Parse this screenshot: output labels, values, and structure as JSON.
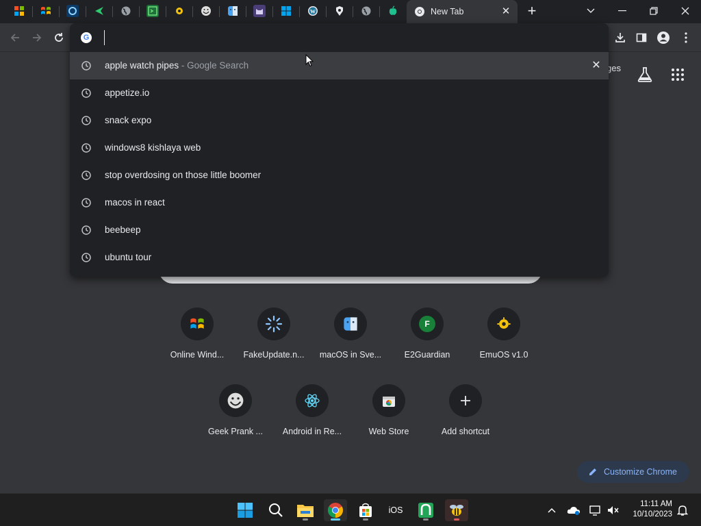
{
  "colors": {
    "accent": "#8ab4f8",
    "tab_bg": "#202124",
    "surface": "#35363a",
    "taskbar": "#1f1f1f"
  },
  "tabs": {
    "pinned_icons": [
      "windows-logo-icon",
      "windows-xp-logo-icon",
      "circle-logo-icon",
      "arrow-logo-icon",
      "globe-icon",
      "green-terminal-icon",
      "yellow-bug-icon",
      "troll-face-icon",
      "finder-icon",
      "cat-icon",
      "windows-icon",
      "wordpress-icon",
      "gear-logo-icon",
      "globe-icon",
      "green-apple-icon"
    ],
    "active_title": "New Tab"
  },
  "omnibox": {
    "value": "",
    "suggestions": [
      {
        "text": "apple watch pipes",
        "sub": " - Google Search"
      },
      {
        "text": "appetize.io",
        "sub": ""
      },
      {
        "text": "snack expo",
        "sub": ""
      },
      {
        "text": "windows8 kishlaya web",
        "sub": ""
      },
      {
        "text": "stop overdosing on those little boomer",
        "sub": ""
      },
      {
        "text": "macos in react",
        "sub": ""
      },
      {
        "text": "beebeep",
        "sub": ""
      },
      {
        "text": "ubuntu tour",
        "sub": ""
      }
    ]
  },
  "ntp": {
    "partial_link": "ges",
    "shortcuts": [
      {
        "label": "Online Wind...",
        "icon": "windows-xp-logo-icon"
      },
      {
        "label": "FakeUpdate.n...",
        "icon": "loading-spinner-icon"
      },
      {
        "label": "macOS in Sve...",
        "icon": "finder-icon"
      },
      {
        "label": "E2Guardian",
        "icon": "letter-f-icon",
        "letter": "F"
      },
      {
        "label": "EmuOS v1.0",
        "icon": "yellow-bug-icon"
      },
      {
        "label": "Geek Prank ...",
        "icon": "troll-face-icon"
      },
      {
        "label": "Android in Re...",
        "icon": "react-atom-icon"
      },
      {
        "label": "Web Store",
        "icon": "web-store-icon"
      },
      {
        "label": "Add shortcut",
        "icon": "plus-icon"
      }
    ],
    "customize_label": "Customize Chrome"
  },
  "taskbar": {
    "ios_label": "iOS",
    "time": "11:11 AM",
    "date": "10/10/2023"
  }
}
